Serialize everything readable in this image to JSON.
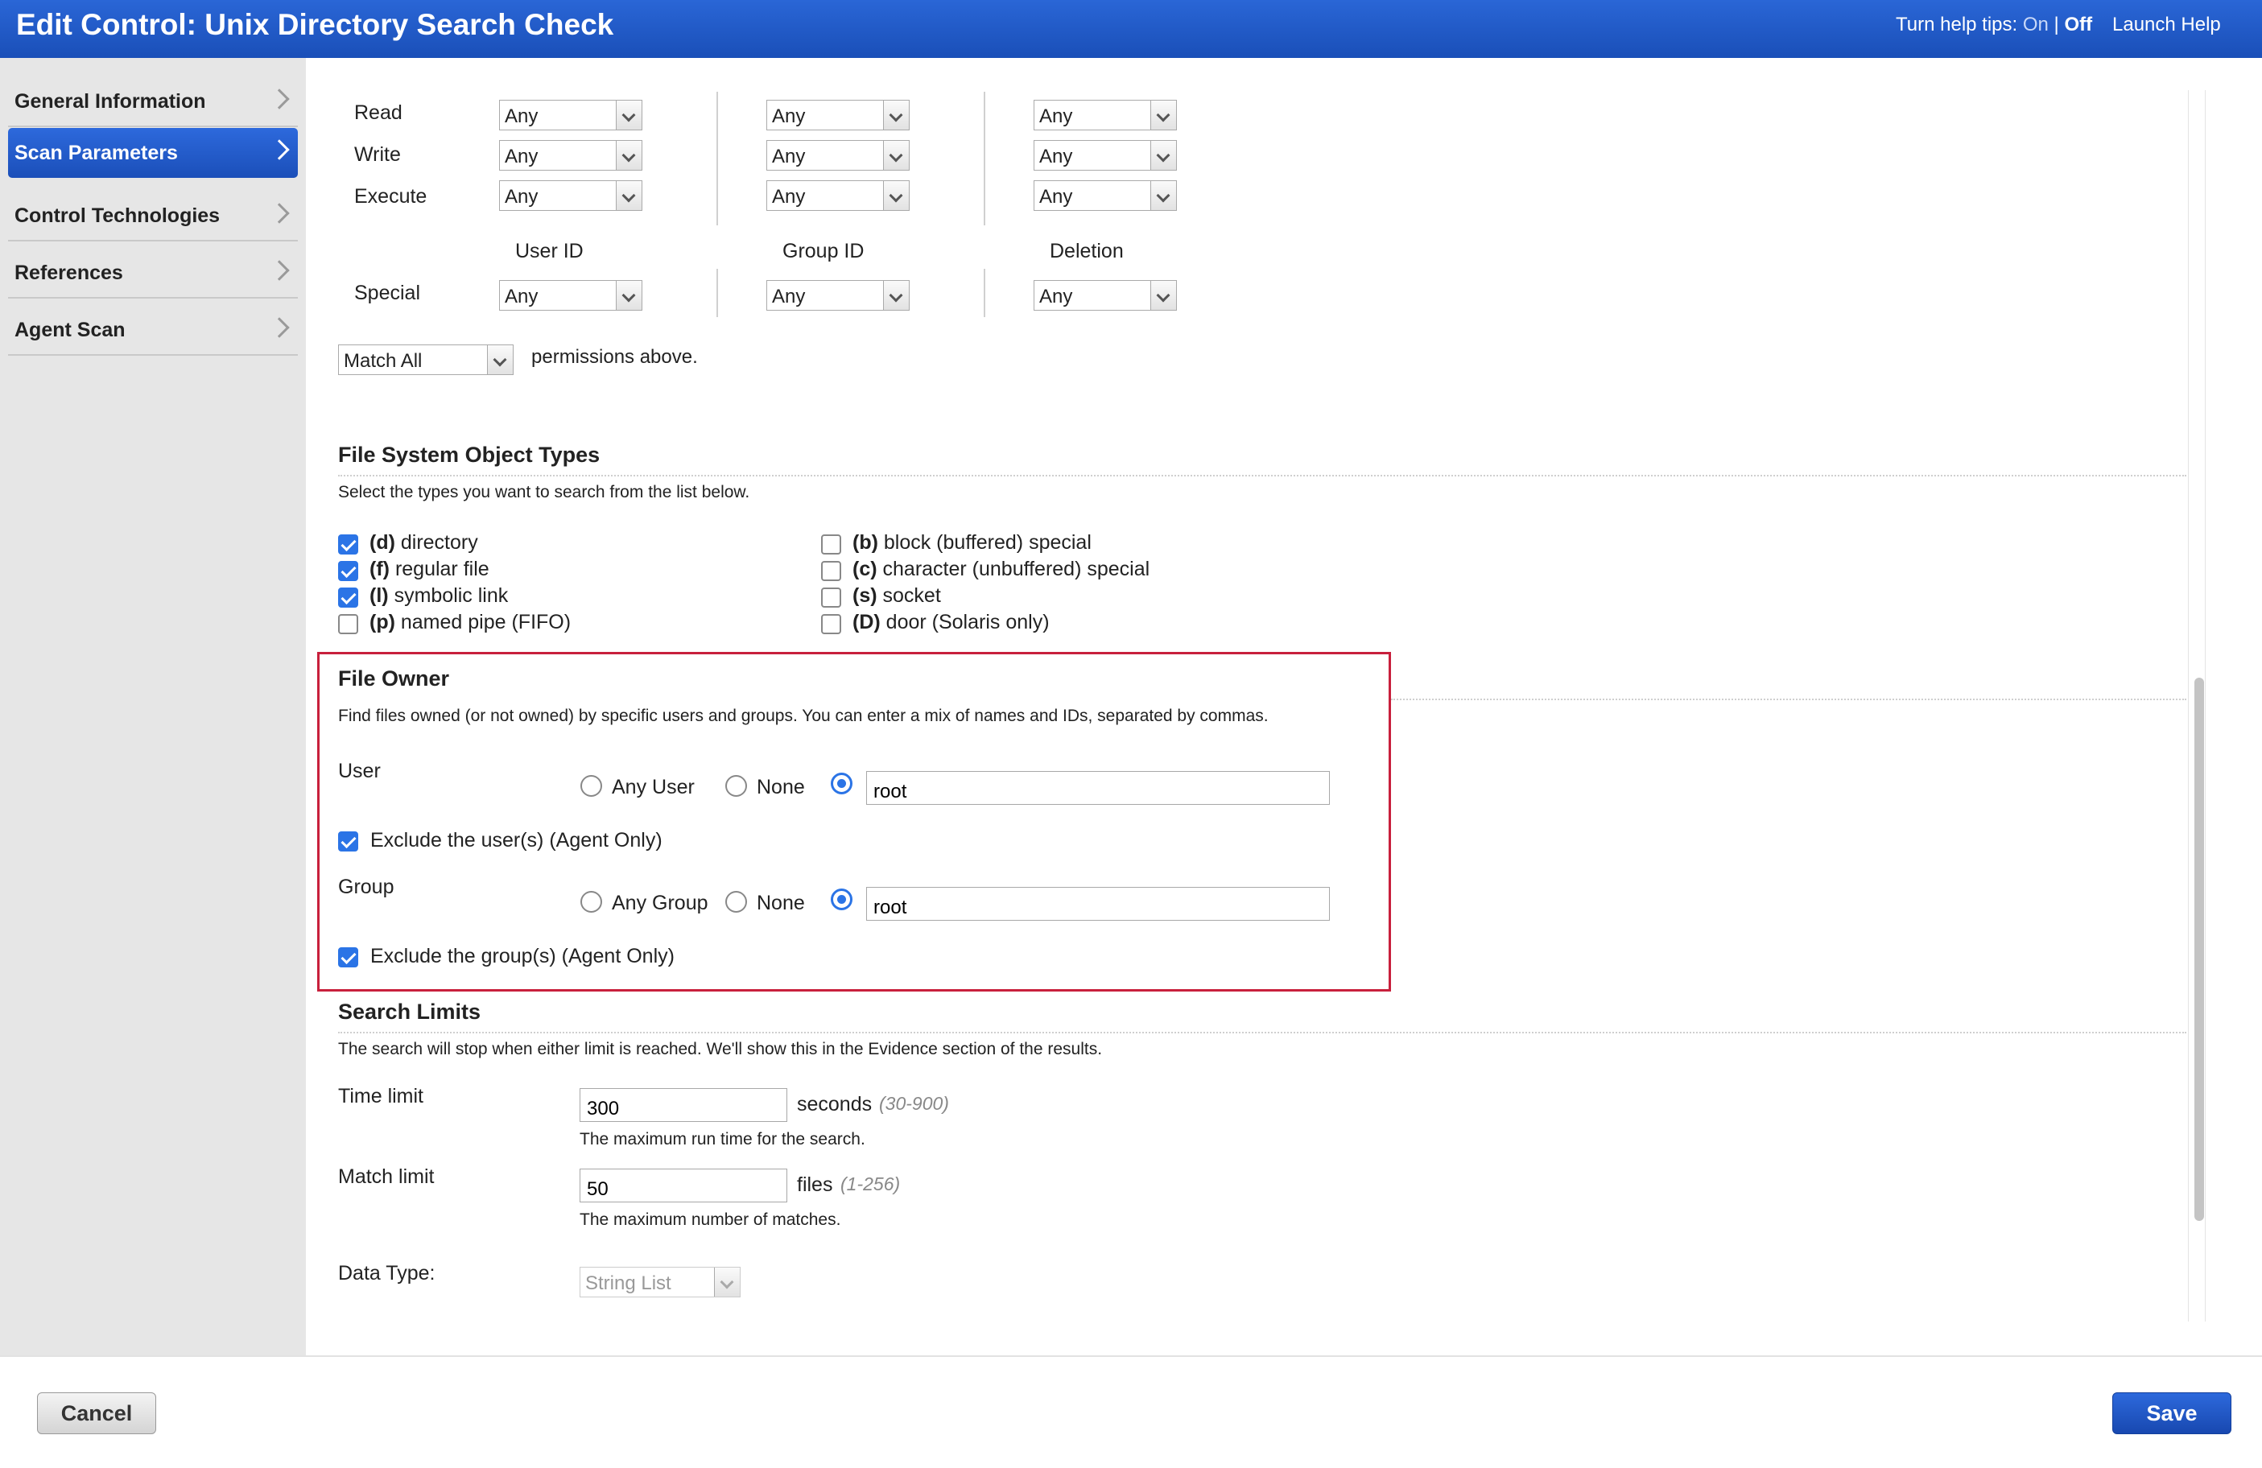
{
  "header": {
    "title": "Edit Control: Unix Directory Search Check",
    "help_tips_label": "Turn help tips:",
    "help_on": "On",
    "help_sep": "|",
    "help_off": "Off",
    "launch_help": "Launch Help"
  },
  "sidebar": {
    "items": [
      {
        "label": "General Information"
      },
      {
        "label": "Scan Parameters",
        "active": true
      },
      {
        "label": "Control Technologies"
      },
      {
        "label": "References"
      },
      {
        "label": "Agent Scan"
      }
    ]
  },
  "permissions": {
    "rows": [
      "Read",
      "Write",
      "Execute"
    ],
    "column_headers": [
      "User ID",
      "Group ID",
      "Deletion"
    ],
    "special_label": "Special",
    "select_value": "Any",
    "match_value": "Match All",
    "match_suffix": "permissions above."
  },
  "object_types": {
    "heading": "File System Object Types",
    "description": "Select the types you want to search from the list below.",
    "items": [
      {
        "code": "(d)",
        "label": "directory",
        "checked": true
      },
      {
        "code": "(f)",
        "label": "regular file",
        "checked": true
      },
      {
        "code": "(l)",
        "label": "symbolic link",
        "checked": true
      },
      {
        "code": "(p)",
        "label": "named pipe (FIFO)",
        "checked": false
      },
      {
        "code": "(b)",
        "label": "block (buffered) special",
        "checked": false
      },
      {
        "code": "(c)",
        "label": "character (unbuffered) special",
        "checked": false
      },
      {
        "code": "(s)",
        "label": "socket",
        "checked": false
      },
      {
        "code": "(D)",
        "label": "door (Solaris only)",
        "checked": false
      }
    ]
  },
  "file_owner": {
    "heading": "File Owner",
    "description": "Find files owned (or not owned) by specific users and groups. You can enter a mix of names and IDs, separated by commas.",
    "user_label": "User",
    "any_user": "Any User",
    "none": "None",
    "user_value": "root",
    "exclude_user": "Exclude the user(s) (Agent Only)",
    "group_label": "Group",
    "any_group": "Any Group",
    "group_value": "root",
    "exclude_group": "Exclude the group(s) (Agent Only)"
  },
  "search_limits": {
    "heading": "Search Limits",
    "description": "The search will stop when either limit is reached. We'll show this in the Evidence section of the results.",
    "time_label": "Time limit",
    "time_value": "300",
    "time_unit": "seconds",
    "time_range": "(30-900)",
    "time_hint": "The maximum run time for the search.",
    "match_label": "Match limit",
    "match_value": "50",
    "match_unit": "files",
    "match_range": "(1-256)",
    "match_hint": "The maximum number of matches.",
    "data_type_label": "Data Type:",
    "data_type_value": "String List"
  },
  "footer": {
    "cancel": "Cancel",
    "save": "Save"
  },
  "colors": {
    "header_blue": "#1f58c4",
    "accent": "#2b74e6",
    "highlight_border": "#c8203c"
  }
}
